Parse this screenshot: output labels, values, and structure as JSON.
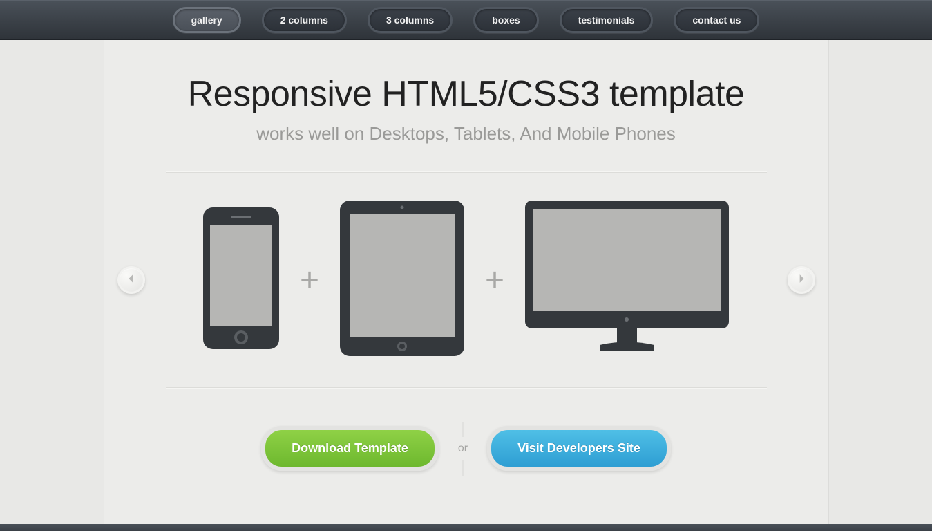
{
  "nav": {
    "items": [
      {
        "label": "gallery",
        "active": true
      },
      {
        "label": "2 columns",
        "active": false
      },
      {
        "label": "3 columns",
        "active": false
      },
      {
        "label": "boxes",
        "active": false
      },
      {
        "label": "testimonials",
        "active": false
      },
      {
        "label": "contact us",
        "active": false
      }
    ]
  },
  "hero": {
    "title": "Responsive HTML5/CSS3 template",
    "subtitle": "works well on Desktops, Tablets, And Mobile Phones"
  },
  "gallery": {
    "plus": "+"
  },
  "cta": {
    "download_label": "Download Template",
    "or_label": "or",
    "visit_label": "Visit Developers Site"
  },
  "colors": {
    "nav_bg": "#3c4249",
    "green": "#7cc537",
    "blue": "#3aaedd",
    "device": "#34383c"
  }
}
